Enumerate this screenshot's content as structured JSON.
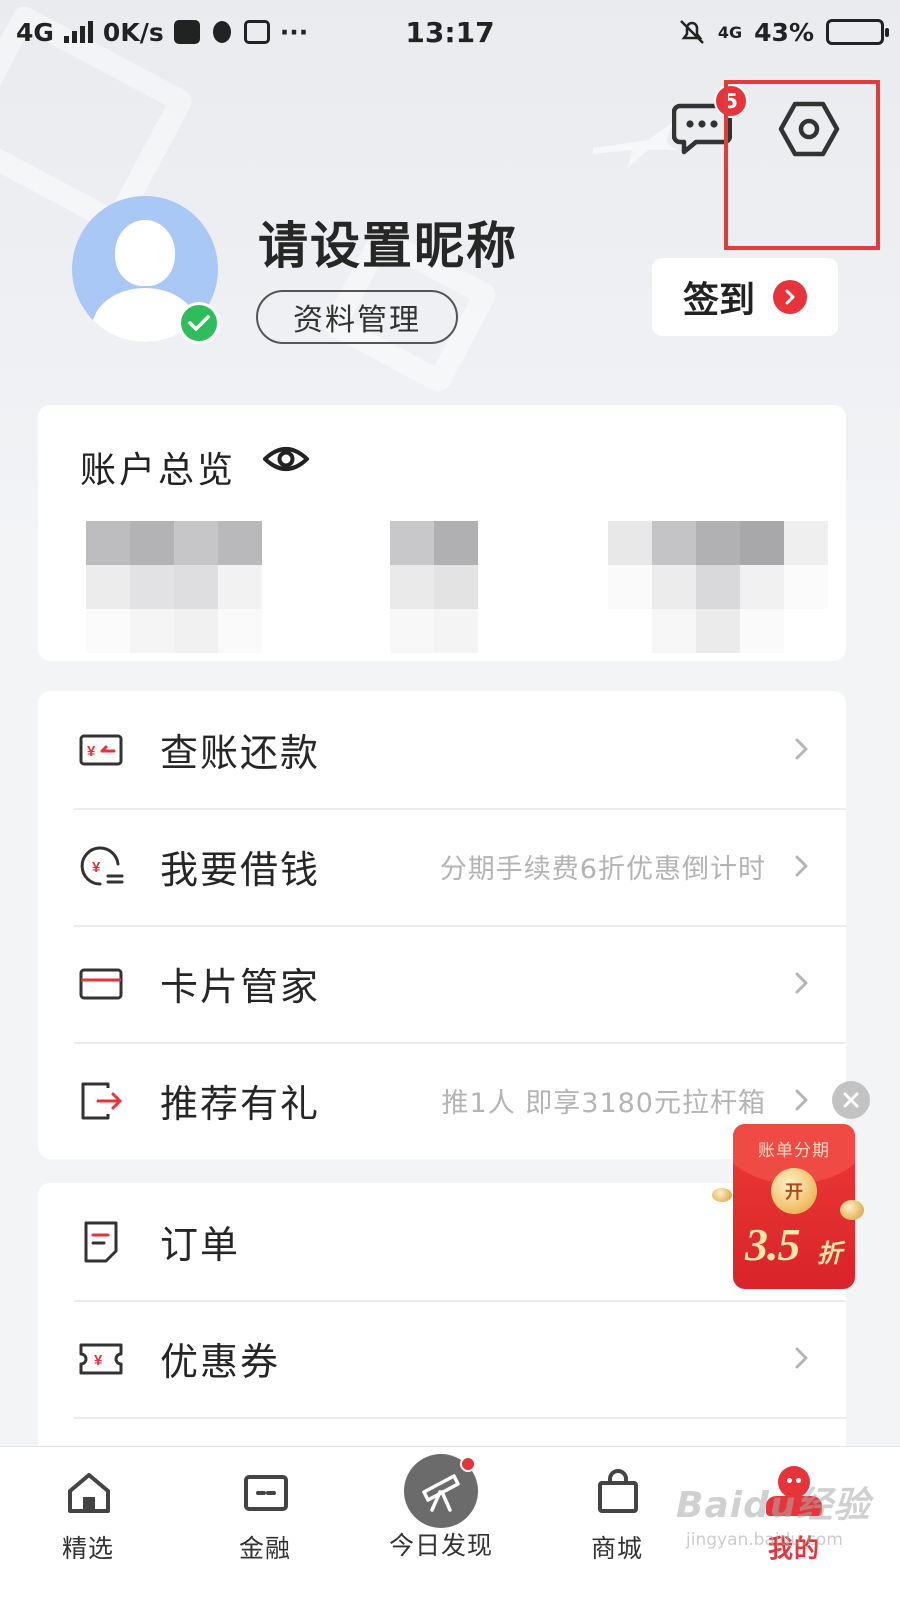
{
  "status_bar": {
    "network": "4G",
    "speed": "0K/s",
    "more": "···",
    "time": "13:17",
    "network_right": "4G",
    "battery_text": "43%",
    "battery_level": 0.43
  },
  "header": {
    "message_badge": "5",
    "nickname": "请设置昵称",
    "profile_button": "资料管理",
    "checkin_button": "签到"
  },
  "account": {
    "title": "账户总览"
  },
  "menu_group_1": [
    {
      "icon": "bill-repay-icon",
      "label": "查账还款",
      "hint": ""
    },
    {
      "icon": "borrow-money-icon",
      "label": "我要借钱",
      "hint": "分期手续费6折优惠倒计时"
    },
    {
      "icon": "card-manager-icon",
      "label": "卡片管家",
      "hint": ""
    },
    {
      "icon": "referral-icon",
      "label": "推荐有礼",
      "hint": "推1人 即享3180元拉杆箱"
    }
  ],
  "menu_group_2": [
    {
      "icon": "order-icon",
      "label": "订单",
      "hint": ""
    },
    {
      "icon": "coupon-icon",
      "label": "优惠券",
      "hint": ""
    }
  ],
  "promo": {
    "title": "账单分期",
    "coin_label": "开",
    "value": "3.5",
    "unit": "折"
  },
  "bottom_nav": [
    {
      "label": "精选",
      "icon": "home-icon"
    },
    {
      "label": "金融",
      "icon": "finance-card-icon"
    },
    {
      "label": "今日发现",
      "icon": "telescope-icon"
    },
    {
      "label": "商城",
      "icon": "shopping-bag-icon"
    },
    {
      "label": "我的",
      "icon": "mine-icon"
    }
  ],
  "watermark": {
    "main": "Baidu经验",
    "sub": "jingyan.baidu.com"
  },
  "colors": {
    "accent_red": "#e6343a",
    "verified_green": "#2ebd5a",
    "avatar_blue": "#a9c8f6"
  }
}
